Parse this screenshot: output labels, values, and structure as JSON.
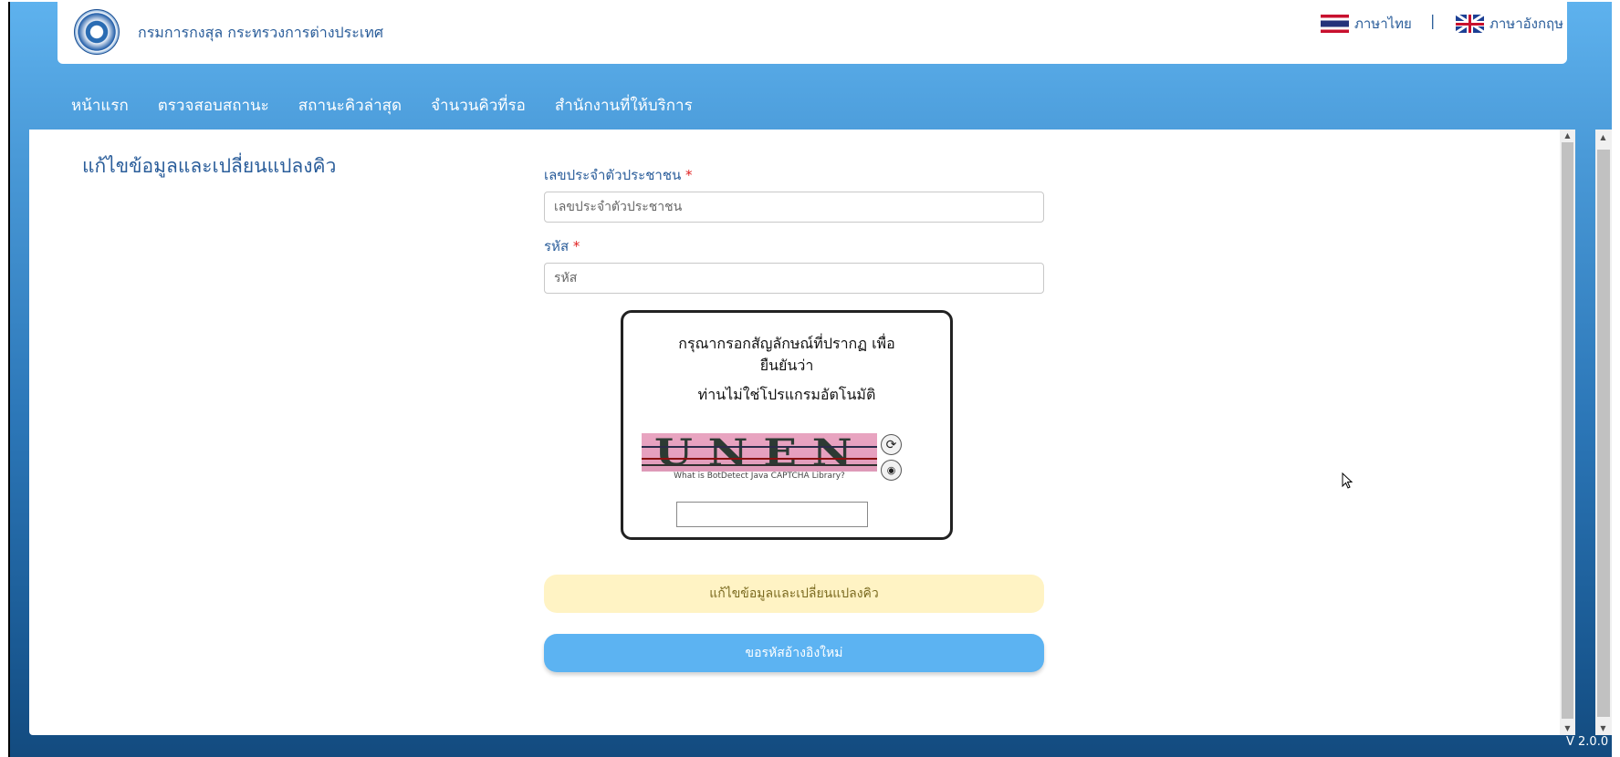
{
  "header": {
    "org_name": "กรมการกงสุล กระทรวงการต่างประเทศ",
    "lang_thai": "ภาษาไทย",
    "lang_sep": "|",
    "lang_english": "ภาษาอังกฤษ"
  },
  "nav": {
    "items": [
      {
        "label": "หน้าแรก"
      },
      {
        "label": "ตรวจสอบสถานะ"
      },
      {
        "label": "สถานะคิวล่าสุด"
      },
      {
        "label": "จำนวนคิวที่รอ"
      },
      {
        "label": "สำนักงานที่ให้บริการ"
      }
    ]
  },
  "page": {
    "title": "แก้ไขข้อมูลและเปลี่ยนแปลงคิว"
  },
  "form": {
    "id_label": "เลขประจำตัวประชาชน",
    "id_required": "*",
    "id_placeholder": "เลขประจำตัวประชาชน",
    "id_value": "",
    "code_label": "รหัส",
    "code_required": "*",
    "code_placeholder": "รหัส",
    "code_value": ""
  },
  "captcha": {
    "prompt_line1": "กรุณากรอกสัญลักษณ์ที่ปรากฏ เพื่อ",
    "prompt_line2": "ยืนยันว่า",
    "prompt_line3": "ท่านไม่ใช่โปรแกรมอัตโนมัติ",
    "image_text": "UNEN",
    "caption": "What is BotDetect Java CAPTCHA Library?",
    "reload_icon": "refresh-icon",
    "audio_icon": "sound-icon",
    "input_value": ""
  },
  "buttons": {
    "edit_label": "แก้ไขข้อมูลและเปลี่ยนแปลงคิว",
    "request_code_label": "ขอรหัสอ้างอิงใหม่"
  },
  "footer": {
    "version": "V 2.0.0"
  },
  "colors": {
    "brand_blue": "#2a5d9a",
    "nav_bg": "#5eb2ee",
    "edit_button_bg": "#fff3c4",
    "request_button_bg": "#5cb3f2",
    "required_star": "#e02020"
  }
}
